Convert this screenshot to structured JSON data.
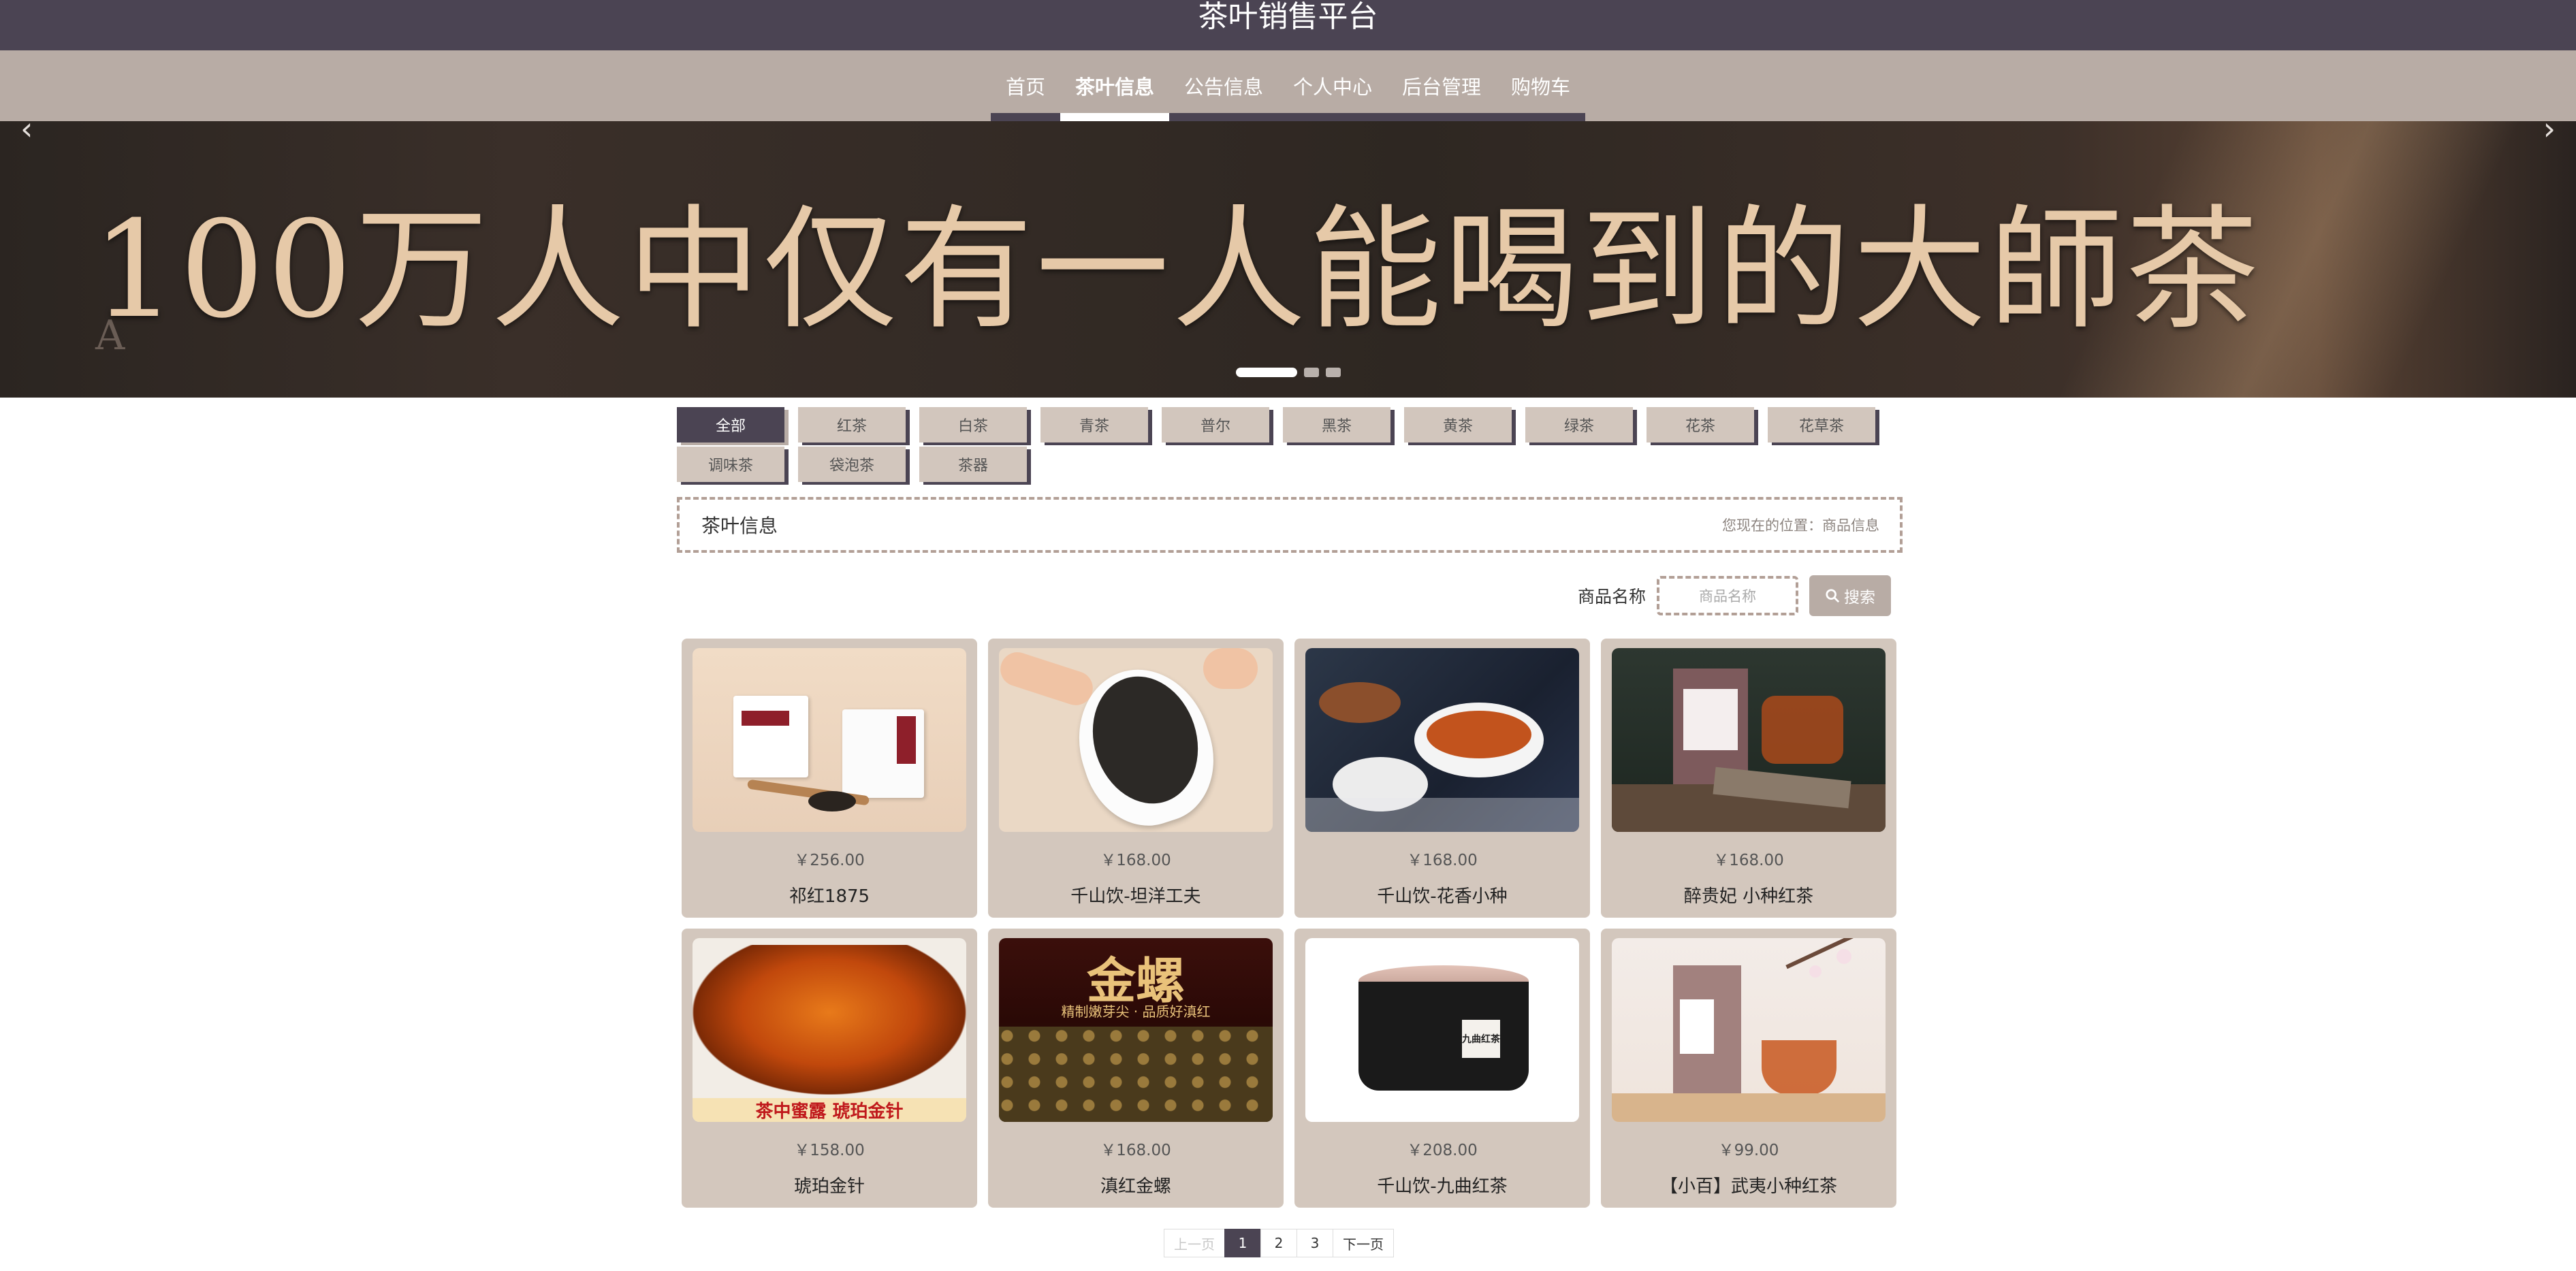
{
  "header": {
    "title": "茶叶销售平台"
  },
  "nav": [
    {
      "label": "首页",
      "active": false
    },
    {
      "label": "茶叶信息",
      "active": true
    },
    {
      "label": "公告信息",
      "active": false
    },
    {
      "label": "个人中心",
      "active": false
    },
    {
      "label": "后台管理",
      "active": false
    },
    {
      "label": "购物车",
      "active": false
    }
  ],
  "banner": {
    "slogan": "100万人中仅有一人能喝到的大師茶",
    "prev_label": "‹",
    "next_label": "›"
  },
  "categories": [
    "全部",
    "红茶",
    "白茶",
    "青茶",
    "普尔",
    "黑茶",
    "黄茶",
    "绿茶",
    "花茶",
    "花草茶",
    "调味茶",
    "袋泡茶",
    "茶器"
  ],
  "breadcrumb": {
    "title": "茶叶信息",
    "location": "您现在的位置：商品信息"
  },
  "search": {
    "label": "商品名称",
    "placeholder": "商品名称",
    "button": "搜索"
  },
  "products": [
    {
      "price": "￥256.00",
      "name": "祁红1875"
    },
    {
      "price": "￥168.00",
      "name": "千山饮-坦洋工夫"
    },
    {
      "price": "￥168.00",
      "name": "千山饮-花香小种"
    },
    {
      "price": "￥168.00",
      "name": "醉贵妃 小种红茶"
    },
    {
      "price": "￥158.00",
      "name": "琥珀金针",
      "caption": "茶中蜜露 琥珀金针"
    },
    {
      "price": "￥168.00",
      "name": "滇红金螺",
      "caption_title": "金螺",
      "caption": "精制嫩芽尖 · 品质好滇红"
    },
    {
      "price": "￥208.00",
      "name": "千山饮-九曲红茶",
      "caption": "九曲红茶"
    },
    {
      "price": "￥99.00",
      "name": "【小百】武夷小种红茶"
    }
  ],
  "pagination": {
    "prev": "上一页",
    "pages": [
      "1",
      "2",
      "3"
    ],
    "current": "1",
    "next": "下一页"
  },
  "colors": {
    "primary": "#4b4453",
    "secondary": "#b8aca5",
    "card": "#d3c7bd"
  }
}
